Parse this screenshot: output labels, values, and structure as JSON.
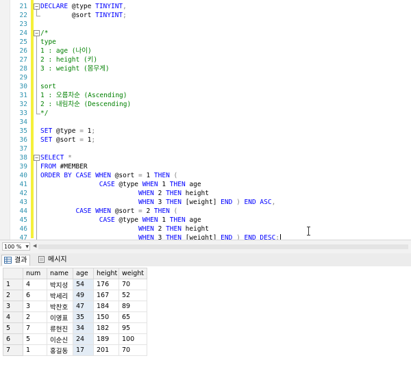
{
  "editor": {
    "lines": [
      {
        "n": "21",
        "tokens": [
          {
            "c": "kw",
            "t": "DECLARE"
          },
          {
            "c": "tx",
            "t": " @type "
          },
          {
            "c": "kw",
            "t": "TINYINT"
          },
          {
            "c": "gy",
            "t": ","
          }
        ]
      },
      {
        "n": "22",
        "tokens": [
          {
            "c": "tx",
            "t": "        @sort "
          },
          {
            "c": "kw",
            "t": "TINYINT"
          },
          {
            "c": "gy",
            "t": ";"
          }
        ]
      },
      {
        "n": "23",
        "tokens": []
      },
      {
        "n": "24",
        "tokens": [
          {
            "c": "cm",
            "t": "/*"
          }
        ]
      },
      {
        "n": "25",
        "tokens": [
          {
            "c": "cm",
            "t": "type"
          }
        ]
      },
      {
        "n": "26",
        "tokens": [
          {
            "c": "cm",
            "t": "1 : age (나이)"
          }
        ]
      },
      {
        "n": "27",
        "tokens": [
          {
            "c": "cm",
            "t": "2 : height (키)"
          }
        ]
      },
      {
        "n": "28",
        "tokens": [
          {
            "c": "cm",
            "t": "3 : weight (몸무게)"
          }
        ]
      },
      {
        "n": "29",
        "tokens": []
      },
      {
        "n": "30",
        "tokens": [
          {
            "c": "cm",
            "t": "sort"
          }
        ]
      },
      {
        "n": "31",
        "tokens": [
          {
            "c": "cm",
            "t": "1 : 오름차순 (Ascending)"
          }
        ]
      },
      {
        "n": "32",
        "tokens": [
          {
            "c": "cm",
            "t": "2 : 내림차순 (Descending)"
          }
        ]
      },
      {
        "n": "33",
        "tokens": [
          {
            "c": "cm",
            "t": "*/"
          }
        ]
      },
      {
        "n": "34",
        "tokens": []
      },
      {
        "n": "35",
        "tokens": [
          {
            "c": "kw",
            "t": "SET"
          },
          {
            "c": "tx",
            "t": " @type "
          },
          {
            "c": "gy",
            "t": "="
          },
          {
            "c": "tx",
            "t": " 1"
          },
          {
            "c": "gy",
            "t": ";"
          }
        ]
      },
      {
        "n": "36",
        "tokens": [
          {
            "c": "kw",
            "t": "SET"
          },
          {
            "c": "tx",
            "t": " @sort "
          },
          {
            "c": "gy",
            "t": "="
          },
          {
            "c": "tx",
            "t": " 1"
          },
          {
            "c": "gy",
            "t": ";"
          }
        ]
      },
      {
        "n": "37",
        "tokens": []
      },
      {
        "n": "38",
        "tokens": [
          {
            "c": "kw",
            "t": "SELECT"
          },
          {
            "c": "tx",
            "t": " "
          },
          {
            "c": "gy",
            "t": "*"
          }
        ]
      },
      {
        "n": "39",
        "tokens": [
          {
            "c": "kw",
            "t": "FROM"
          },
          {
            "c": "tx",
            "t": " #MEMBER"
          }
        ]
      },
      {
        "n": "40",
        "tokens": [
          {
            "c": "kw",
            "t": "ORDER BY CASE WHEN"
          },
          {
            "c": "tx",
            "t": " @sort "
          },
          {
            "c": "gy",
            "t": "="
          },
          {
            "c": "tx",
            "t": " 1 "
          },
          {
            "c": "kw",
            "t": "THEN"
          },
          {
            "c": "tx",
            "t": " "
          },
          {
            "c": "gy",
            "t": "("
          }
        ]
      },
      {
        "n": "41",
        "tokens": [
          {
            "c": "tx",
            "t": "               "
          },
          {
            "c": "kw",
            "t": "CASE"
          },
          {
            "c": "tx",
            "t": " @type "
          },
          {
            "c": "kw",
            "t": "WHEN"
          },
          {
            "c": "tx",
            "t": " 1 "
          },
          {
            "c": "kw",
            "t": "THEN"
          },
          {
            "c": "tx",
            "t": " age"
          }
        ]
      },
      {
        "n": "42",
        "tokens": [
          {
            "c": "tx",
            "t": "                         "
          },
          {
            "c": "kw",
            "t": "WHEN"
          },
          {
            "c": "tx",
            "t": " 2 "
          },
          {
            "c": "kw",
            "t": "THEN"
          },
          {
            "c": "tx",
            "t": " height"
          }
        ]
      },
      {
        "n": "43",
        "tokens": [
          {
            "c": "tx",
            "t": "                         "
          },
          {
            "c": "kw",
            "t": "WHEN"
          },
          {
            "c": "tx",
            "t": " 3 "
          },
          {
            "c": "kw",
            "t": "THEN"
          },
          {
            "c": "tx",
            "t": " [weight] "
          },
          {
            "c": "kw",
            "t": "END"
          },
          {
            "c": "tx",
            "t": " "
          },
          {
            "c": "gy",
            "t": ")"
          },
          {
            "c": "tx",
            "t": " "
          },
          {
            "c": "kw",
            "t": "END ASC"
          },
          {
            "c": "gy",
            "t": ","
          }
        ]
      },
      {
        "n": "44",
        "tokens": [
          {
            "c": "tx",
            "t": "         "
          },
          {
            "c": "kw",
            "t": "CASE WHEN"
          },
          {
            "c": "tx",
            "t": " @sort "
          },
          {
            "c": "gy",
            "t": "="
          },
          {
            "c": "tx",
            "t": " 2 "
          },
          {
            "c": "kw",
            "t": "THEN"
          },
          {
            "c": "tx",
            "t": " "
          },
          {
            "c": "gy",
            "t": "("
          }
        ]
      },
      {
        "n": "45",
        "tokens": [
          {
            "c": "tx",
            "t": "               "
          },
          {
            "c": "kw",
            "t": "CASE"
          },
          {
            "c": "tx",
            "t": " @type "
          },
          {
            "c": "kw",
            "t": "WHEN"
          },
          {
            "c": "tx",
            "t": " 1 "
          },
          {
            "c": "kw",
            "t": "THEN"
          },
          {
            "c": "tx",
            "t": " age"
          }
        ]
      },
      {
        "n": "46",
        "tokens": [
          {
            "c": "tx",
            "t": "                         "
          },
          {
            "c": "kw",
            "t": "WHEN"
          },
          {
            "c": "tx",
            "t": " 2 "
          },
          {
            "c": "kw",
            "t": "THEN"
          },
          {
            "c": "tx",
            "t": " height"
          }
        ]
      },
      {
        "n": "47",
        "tokens": [
          {
            "c": "tx",
            "t": "                         "
          },
          {
            "c": "kw",
            "t": "WHEN"
          },
          {
            "c": "tx",
            "t": " 3 "
          },
          {
            "c": "kw",
            "t": "THEN"
          },
          {
            "c": "tx",
            "t": " [weight] "
          },
          {
            "c": "kw",
            "t": "END"
          },
          {
            "c": "tx",
            "t": " "
          },
          {
            "c": "gy",
            "t": ")"
          },
          {
            "c": "tx",
            "t": " "
          },
          {
            "c": "kw",
            "t": "END DESC"
          },
          {
            "c": "gy",
            "t": ";"
          }
        ]
      }
    ]
  },
  "statusbar": {
    "zoom": "100 %"
  },
  "tabs": [
    {
      "label": "결과",
      "icon": "results-grid-icon",
      "active": true
    },
    {
      "label": "메시지",
      "icon": "messages-icon",
      "active": false
    }
  ],
  "results": {
    "columns": [
      "num",
      "name",
      "age",
      "height",
      "weight"
    ],
    "rows": [
      [
        "1",
        "4",
        "박지성",
        "54",
        "176",
        "70"
      ],
      [
        "2",
        "6",
        "박세리",
        "49",
        "167",
        "52"
      ],
      [
        "3",
        "3",
        "박찬호",
        "47",
        "184",
        "89"
      ],
      [
        "4",
        "2",
        "이영표",
        "35",
        "150",
        "65"
      ],
      [
        "5",
        "7",
        "류현진",
        "34",
        "182",
        "95"
      ],
      [
        "6",
        "5",
        "이순신",
        "24",
        "189",
        "100"
      ],
      [
        "7",
        "1",
        "홍길동",
        "17",
        "201",
        "70"
      ]
    ]
  }
}
